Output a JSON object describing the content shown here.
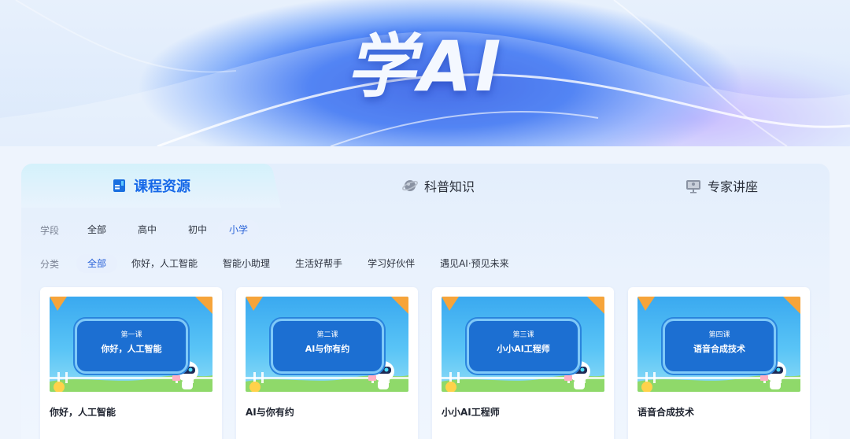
{
  "banner": {
    "title": "学AI"
  },
  "tabs": [
    {
      "label": "课程资源",
      "icon": "book-icon",
      "active": true
    },
    {
      "label": "科普知识",
      "icon": "planet-icon",
      "active": false
    },
    {
      "label": "专家讲座",
      "icon": "lecture-screen-icon",
      "active": false
    }
  ],
  "filters": {
    "stage": {
      "label": "学段",
      "options": [
        "全部",
        "高中",
        "初中",
        "小学"
      ],
      "selected": "小学"
    },
    "category": {
      "label": "分类",
      "options": [
        "全部",
        "你好，人工智能",
        "智能小助理",
        "生活好帮手",
        "学习好伙伴",
        "遇见AI·预见未来"
      ],
      "selected": "全部"
    }
  },
  "cards": [
    {
      "lesson": "第一课",
      "board_title": "你好，人工智能",
      "title": "你好，人工智能"
    },
    {
      "lesson": "第二课",
      "board_title": "AI与你有约",
      "title": "AI与你有约"
    },
    {
      "lesson": "第三课",
      "board_title": "小小AI工程师",
      "title": "小小AI工程师"
    },
    {
      "lesson": "第四课",
      "board_title": "语音合成技术",
      "title": "语音合成技术"
    }
  ],
  "colors": {
    "accent": "#1668e8",
    "chip_bg": "#e8f0fd",
    "board": "#1c6fd2"
  }
}
